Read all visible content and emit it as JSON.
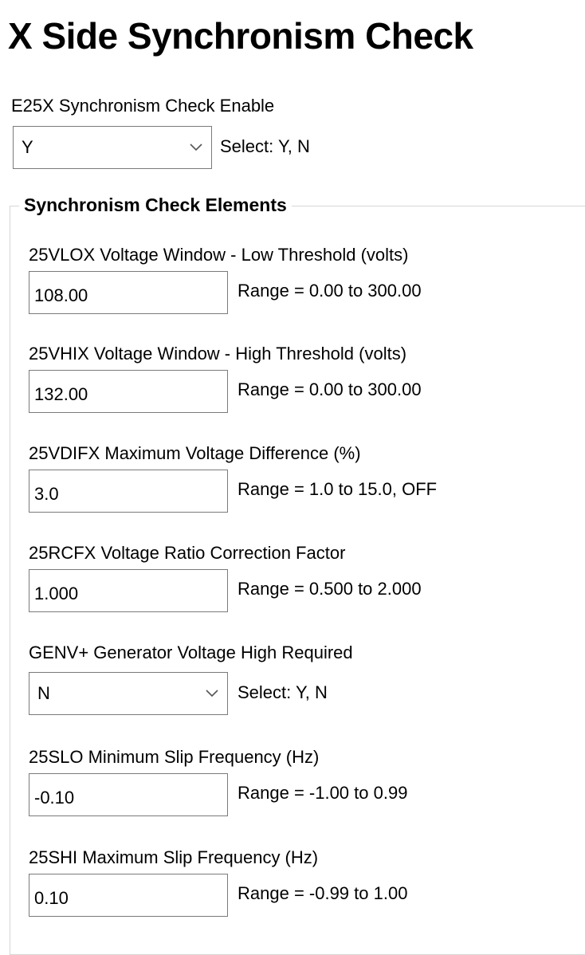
{
  "page": {
    "title": "X Side Synchronism Check"
  },
  "enable": {
    "label": "E25X  Synchronism Check Enable",
    "value": "Y",
    "hint": "Select: Y, N"
  },
  "group": {
    "title": "Synchronism Check Elements",
    "fields": [
      {
        "label": "25VLOX  Voltage Window - Low Threshold (volts)",
        "value": "108.00",
        "hint": "Range = 0.00 to 300.00"
      },
      {
        "label": "25VHIX  Voltage Window - High Threshold (volts)",
        "value": "132.00",
        "hint": "Range = 0.00 to 300.00"
      },
      {
        "label": "25VDIFX  Maximum Voltage Difference (%)",
        "value": "3.0",
        "hint": "Range = 1.0 to 15.0, OFF"
      },
      {
        "label": "25RCFX  Voltage Ratio Correction Factor",
        "value": "1.000",
        "hint": "Range = 0.500 to 2.000"
      },
      {
        "label": "GENV+  Generator Voltage High Required",
        "value": "N",
        "hint": "Select: Y, N"
      },
      {
        "label": "25SLO  Minimum Slip Frequency (Hz)",
        "value": "-0.10",
        "hint": "Range = -1.00 to 0.99"
      },
      {
        "label": "25SHI  Maximum Slip Frequency (Hz)",
        "value": "0.10",
        "hint": "Range = -0.99 to 1.00"
      }
    ]
  },
  "icons": {
    "dropdown": "chevron-down-icon"
  }
}
